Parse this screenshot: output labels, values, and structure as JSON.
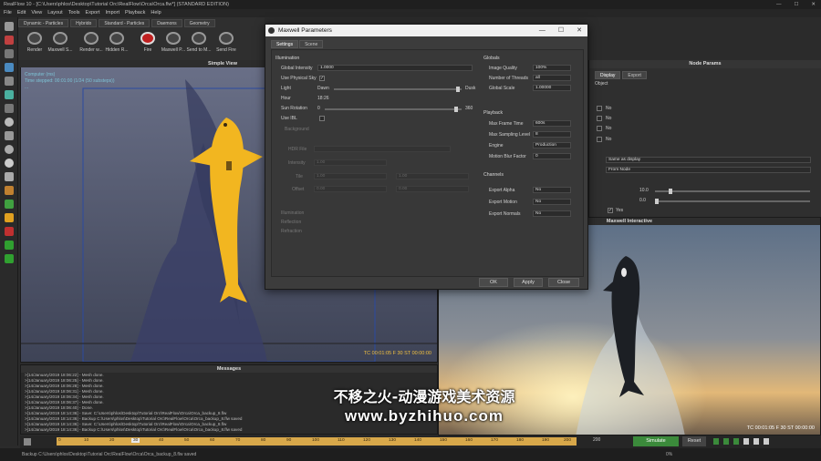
{
  "app": {
    "title": "RealFlow 10 - [C:\\Users\\phlos\\Desktop\\Tutorial Orc\\RealFlow\\Orca\\Orca.flw*] (STANDARD EDITION)",
    "menu": [
      "File",
      "Edit",
      "View",
      "Layout",
      "Tools",
      "Export",
      "Import",
      "Playback",
      "Help"
    ]
  },
  "toolbar": {
    "tabs": [
      "Dynamic - Particles",
      "Hybrido",
      "Standard - Particles",
      "Daemons",
      "Geometry"
    ],
    "buttons": [
      "Render",
      "Maxwell S...",
      "Render w...",
      "Hidden R...",
      "Fire",
      "Maxwell P...",
      "Send to M...",
      "Send Fire"
    ]
  },
  "viewport": {
    "title": "Simple View",
    "info": [
      "Computer (ms)",
      "Time stepped: 00:01:00 (1/24 (50 substeps))",
      "...",
      "",
      "",
      ""
    ],
    "footer": "TC 00:01:05   F 30   ST 00:00:00"
  },
  "messages": {
    "title": "Messages",
    "lines": [
      ">[14/January/2019 18:06:22] - Mesh done.",
      ">[14/January/2019 18:06:25] - Mesh done.",
      ">[14/January/2019 18:06:28] - Mesh done.",
      ">[14/January/2019 18:06:31] - Mesh done.",
      ">[14/January/2019 18:06:34] - Mesh done.",
      ">[14/January/2019 18:06:37] - Mesh done.",
      ">[14/January/2019 18:06:40] - Done.",
      ">[14/January/2019 18:14:36] - Save: C:\\Users\\phlos\\Desktop\\Tutorial Orc\\RealFlow\\Orca\\Orca_backup_8.flw",
      ">[14/January/2019 18:14:36] - Backup C:\\Users\\phlos\\Desktop\\Tutorial Orc\\RealFlow\\Orca\\Orca_backup_8.flw saved",
      ">[14/January/2019 18:14:36] - Save: C:\\Users\\phlos\\Desktop\\Tutorial Orc\\RealFlow\\Orca\\Orca_backup_8.flw",
      ">[14/January/2019 18:14:36] - Backup C:\\Users\\phlos\\Desktop\\Tutorial Orc\\RealFlow\\Orca\\Orca_backup_8.flw saved"
    ]
  },
  "node_params": {
    "title": "Node Params",
    "tabs": [
      "Display",
      "Export"
    ],
    "object_label": "Object",
    "rows": [
      "No",
      "No",
      "No",
      "No"
    ],
    "same_as_display": "Same as display",
    "from_node": "From Node",
    "val1": "10.0",
    "val2": "0.0",
    "yes": "Yes"
  },
  "maxwell_interactive": {
    "title": "Maxwell Interactive",
    "footer": "TC 00:01:05   F 30   ST 00:00:00"
  },
  "dialog": {
    "title": "Maxwell Parameters",
    "tabs": [
      "Settings",
      "Scene"
    ],
    "illumination": {
      "header": "Illumination",
      "global_intensity_label": "Global Intensity",
      "global_intensity": "1.0000",
      "physical_sky_label": "Use Physical Sky",
      "light_label": "Light",
      "light_left": "Dawn",
      "light_right": "Dusk",
      "hour_label": "Hour",
      "hour": "18:26",
      "sun_rotation_label": "Sun Rotation",
      "sun_rotation": "0",
      "sun_rotation_max": "360",
      "use_ibl_label": "Use IBL",
      "background_label": "Background",
      "hdr_file_label": "HDR File",
      "intensity_label": "Intensity",
      "intensity": "1.00",
      "tile_label": "Tile",
      "tile_a": "1.00",
      "tile_b": "1.00",
      "offset_label": "Offset",
      "offset_a": "0.00",
      "offset_b": "0.00",
      "sub_illumination": "Illumination",
      "reflection": "Reflection",
      "refraction": "Refraction"
    },
    "globals": {
      "header": "Globals",
      "image_quality_label": "Image Quality",
      "image_quality": "100%",
      "threads_label": "Number of Threads",
      "threads": "all",
      "global_scale_label": "Global Scale",
      "global_scale": "1.00000"
    },
    "playback": {
      "header": "Playback",
      "max_frame_label": "Max Frame Time",
      "max_frame": "600s",
      "max_sampling_label": "Max Sampling Level",
      "max_sampling": "8",
      "engine_label": "Engine",
      "engine": "Production",
      "motion_blur_label": "Motion Blur Factor",
      "motion_blur": "0"
    },
    "channels": {
      "header": "Channels",
      "export_alpha_label": "Export Alpha",
      "export_alpha": "No",
      "export_motion_label": "Export Motion",
      "export_motion": "No",
      "export_normals_label": "Export Normals",
      "export_normals": "No"
    },
    "ok": "OK",
    "apply": "Apply",
    "close": "Close"
  },
  "timeline": {
    "ticks": [
      "0",
      "10",
      "20",
      "30",
      "40",
      "50",
      "60",
      "70",
      "80",
      "90",
      "100",
      "110",
      "120",
      "130",
      "140",
      "150",
      "160",
      "170",
      "180",
      "190",
      "200"
    ],
    "current": "30",
    "end": "200",
    "simulate": "Simulate",
    "reset": "Reset",
    "percent": "0%"
  },
  "status": {
    "text": "Backup C:\\Users\\phlos\\Desktop\\Tutorial Orc\\RealFlow\\Orca\\Orca_backup_8.flw saved"
  },
  "watermark": {
    "line1": "不移之火-动漫游戏美术资源",
    "line2": "www.byzhihuo.com"
  },
  "colors": {
    "accent": "#d8a84a",
    "orca_yellow": "#f2b620",
    "simulate_green": "#3b8a3b"
  }
}
